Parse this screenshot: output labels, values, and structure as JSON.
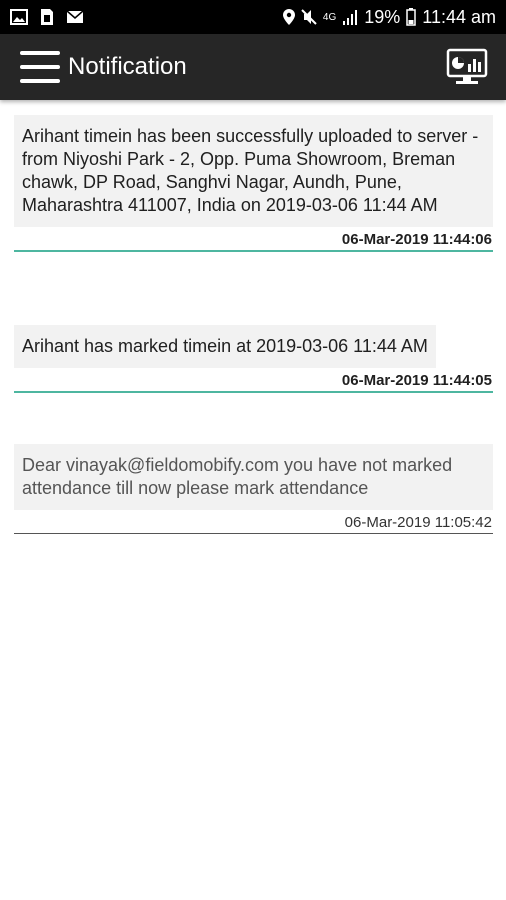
{
  "status_bar": {
    "network": "4G",
    "battery": "19%",
    "time": "11:44 am"
  },
  "app_bar": {
    "title": "Notification"
  },
  "notifications": [
    {
      "message": "Arihant timein has been successfully uploaded to server - from Niyoshi Park - 2, Opp. Puma Showroom, Breman chawk, DP Road, Sanghvi Nagar, Aundh, Pune, Maharashtra 411007, India on 2019-03-06 11:44 AM",
      "timestamp": "06-Mar-2019 11:44:06",
      "read": false
    },
    {
      "message": "Arihant has marked timein at 2019-03-06 11:44 AM",
      "timestamp": "06-Mar-2019 11:44:05",
      "read": false
    },
    {
      "message": "Dear vinayak@fieldomobify.com you have not marked attendance till now please mark attendance",
      "timestamp": "06-Mar-2019 11:05:42",
      "read": true
    }
  ],
  "colors": {
    "app_bar": "#262626",
    "accent_divider": "#4db6a0",
    "bubble_bg": "#f2f2f2"
  }
}
